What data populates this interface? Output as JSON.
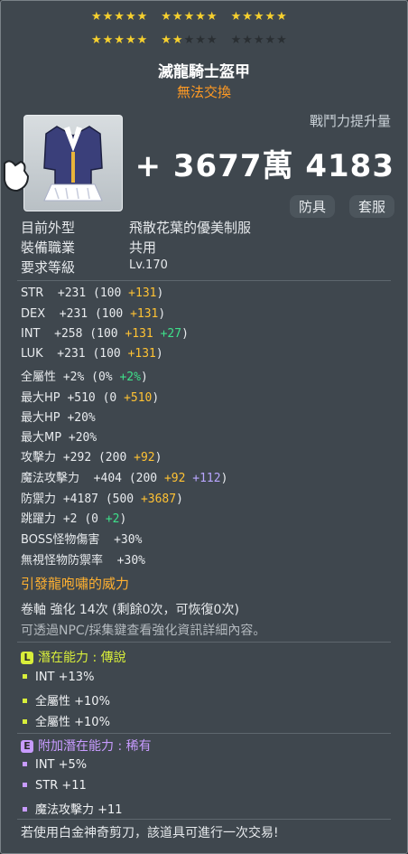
{
  "stars": {
    "row1": "★★★★★ ★★★★★ ★★★★★",
    "row2_filled": 7,
    "row2_total": 15
  },
  "item": {
    "name": "滅龍騎士盔甲",
    "trade": "無法交換"
  },
  "combat": {
    "label": "戰鬥力提升量",
    "value": "+ 3677萬 4183"
  },
  "tags": [
    "防具",
    "套服"
  ],
  "info": [
    {
      "label": "目前外型",
      "value": "飛散花葉的優美制服"
    },
    {
      "label": "裝備職業",
      "value": "共用"
    },
    {
      "label": "要求等級",
      "value": "Lv.170"
    }
  ],
  "stats": [
    {
      "name": "STR",
      "total": "+231",
      "base": "(100",
      "a": "+131",
      "b": "",
      "c": ")"
    },
    {
      "name": "DEX",
      "total": "+231",
      "base": "(100",
      "a": "+131",
      "b": "",
      "c": ")"
    },
    {
      "name": "INT",
      "total": "+258",
      "base": "(100",
      "a": "+131",
      "b": "+27",
      "c": ")"
    },
    {
      "name": "LUK",
      "total": "+231",
      "base": "(100",
      "a": "+131",
      "b": "",
      "c": ")"
    },
    {
      "name": "全屬性",
      "total": "+2%",
      "base": "(0%",
      "a": "",
      "b": "+2%",
      "c": ")"
    },
    {
      "name": "最大HP",
      "total": "+510",
      "base": "(0",
      "a": "+510",
      "b": "",
      "c": ")"
    },
    {
      "name": "最大HP",
      "total": "+20%",
      "base": "",
      "a": "",
      "b": "",
      "c": ""
    },
    {
      "name": "最大MP",
      "total": "+20%",
      "base": "",
      "a": "",
      "b": "",
      "c": ""
    },
    {
      "name": "攻擊力",
      "total": "+292",
      "base": "(200",
      "a": "+92",
      "b": "",
      "c": ")"
    },
    {
      "name": "魔法攻擊力",
      "total": "+404",
      "base": "(200",
      "a": "+92",
      "p": "+112",
      "c": ")"
    },
    {
      "name": "防禦力",
      "total": "+4187",
      "base": "(500",
      "a": "+3687",
      "b": "",
      "c": ")"
    },
    {
      "name": "跳躍力",
      "total": "+2",
      "base": "(0",
      "a": "",
      "b": "+2",
      "c": ")"
    },
    {
      "name": "BOSS怪物傷害",
      "total": "+30%",
      "base": "",
      "a": "",
      "b": "",
      "c": ""
    },
    {
      "name": "無視怪物防禦率",
      "total": "+30%",
      "base": "",
      "a": "",
      "b": "",
      "c": ""
    }
  ],
  "set_effect": "引發龍咆嘯的威力",
  "scroll": "卷軸 強化 14次 (剩餘0次，可恢復0次)",
  "hint": "可透過NPC/採集鍵查看強化資訊詳細內容。",
  "potential": {
    "badge": "L",
    "title": "潛在能力 : 傳說",
    "lines": [
      "INT +13%",
      "全屬性 +10%",
      "全屬性 +10%"
    ]
  },
  "additional": {
    "badge": "E",
    "title": "附加潛在能力 : 稀有",
    "lines": [
      "INT +5%",
      "STR +11",
      "魔法攻擊力 +11"
    ]
  },
  "footer": "若使用白金神奇剪刀，該道具可進行一次交易!",
  "colors": {
    "legendary": "#d8ee3a",
    "epic": "#c89bff",
    "star": "#f6d02e",
    "bonus": "#ffc233",
    "flame": "#3ee08a"
  }
}
